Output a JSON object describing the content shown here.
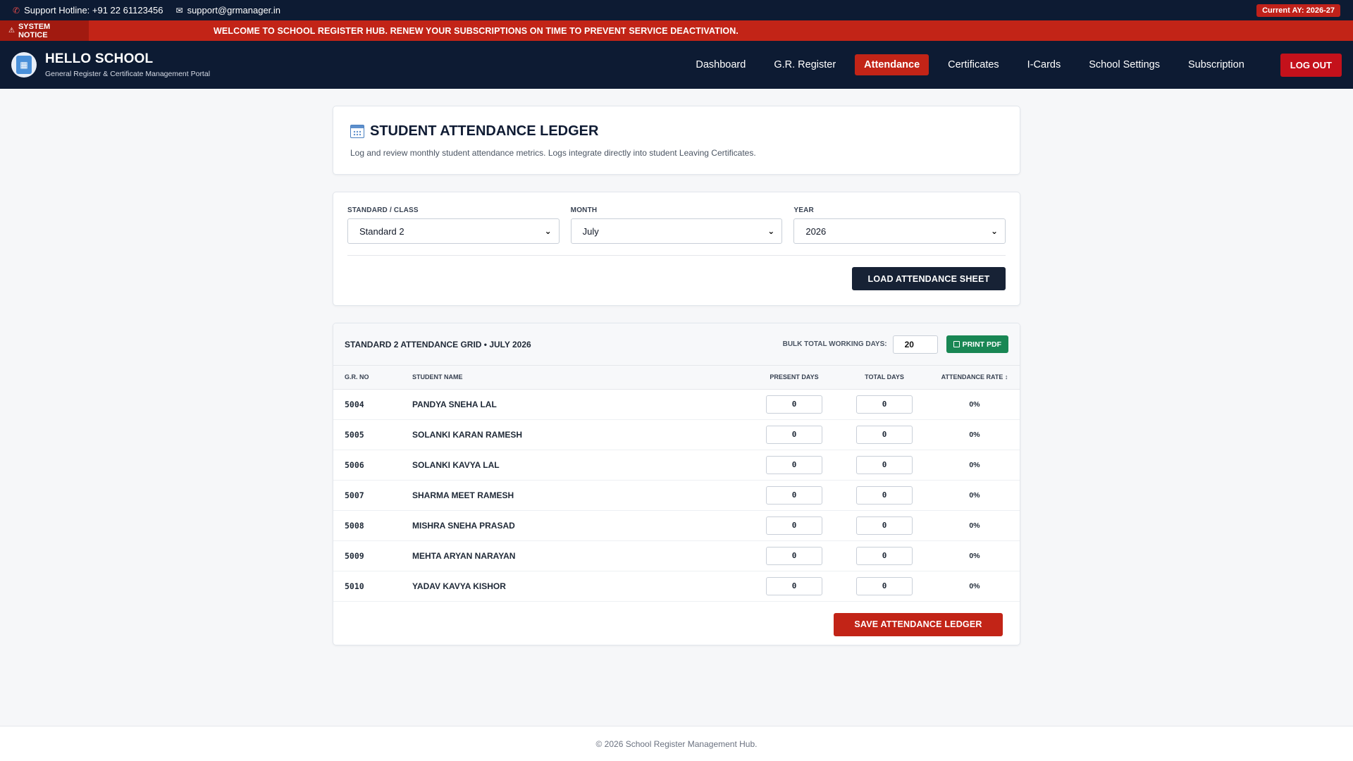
{
  "topbar": {
    "hotline": "Support Hotline: +91 22 61123456",
    "email": "support@grmanager.in",
    "academic_year": "Current AY: 2026-27"
  },
  "notice": {
    "tag": "SYSTEM NOTICE",
    "text": "WELCOME TO SCHOOL REGISTER HUB. RENEW YOUR SUBSCRIPTIONS ON TIME TO PREVENT SERVICE DEACTIVATION."
  },
  "brand": {
    "title": "HELLO SCHOOL",
    "subtitle": "General Register & Certificate Management Portal"
  },
  "nav": {
    "items": [
      "Dashboard",
      "G.R. Register",
      "Attendance",
      "Certificates",
      "I-Cards",
      "School Settings",
      "Subscription"
    ],
    "active": "Attendance",
    "logout": "LOG OUT"
  },
  "header": {
    "title": "STUDENT ATTENDANCE LEDGER",
    "description": "Log and review monthly student attendance metrics. Logs integrate directly into student Leaving Certificates."
  },
  "filters": {
    "standard_label": "STANDARD / CLASS",
    "standard_value": "Standard 2",
    "month_label": "MONTH",
    "month_value": "July",
    "year_label": "YEAR",
    "year_value": "2026",
    "load_button": "LOAD ATTENDANCE SHEET"
  },
  "grid": {
    "title": "STANDARD 2 ATTENDANCE GRID • JULY 2026",
    "bulk_label": "BULK TOTAL WORKING DAYS:",
    "bulk_value": "20",
    "print_button": "PRINT PDF",
    "columns": {
      "gr": "G.R. NO",
      "name": "STUDENT NAME",
      "present": "PRESENT DAYS",
      "total": "TOTAL DAYS",
      "rate": "ATTENDANCE RATE ↕"
    },
    "rows": [
      {
        "gr": "5004",
        "name": "PANDYA SNEHA LAL",
        "present": "0",
        "total": "0",
        "rate": "0%"
      },
      {
        "gr": "5005",
        "name": "SOLANKI KARAN RAMESH",
        "present": "0",
        "total": "0",
        "rate": "0%"
      },
      {
        "gr": "5006",
        "name": "SOLANKI KAVYA LAL",
        "present": "0",
        "total": "0",
        "rate": "0%"
      },
      {
        "gr": "5007",
        "name": "SHARMA MEET RAMESH",
        "present": "0",
        "total": "0",
        "rate": "0%"
      },
      {
        "gr": "5008",
        "name": "MISHRA SNEHA PRASAD",
        "present": "0",
        "total": "0",
        "rate": "0%"
      },
      {
        "gr": "5009",
        "name": "MEHTA ARYAN NARAYAN",
        "present": "0",
        "total": "0",
        "rate": "0%"
      },
      {
        "gr": "5010",
        "name": "YADAV KAVYA KISHOR",
        "present": "0",
        "total": "0",
        "rate": "0%"
      }
    ],
    "save_button": "SAVE ATTENDANCE LEDGER"
  },
  "footer": {
    "text": "© 2026 School Register Management Hub."
  },
  "colors": {
    "navy": "#0d1b33",
    "accent_red": "#c22417",
    "success_green": "#198754"
  }
}
